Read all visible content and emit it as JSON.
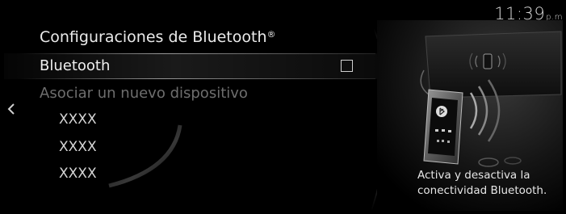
{
  "status": {
    "time": "11:39",
    "ampm": "p.m"
  },
  "menu": {
    "title": "Configuraciones de Bluetooth",
    "title_mark": "®",
    "bluetooth_label": "Bluetooth",
    "bluetooth_checked": false,
    "pair_label": "Asociar un nuevo dispositivo",
    "devices": [
      "XXXX",
      "XXXX",
      "XXXX"
    ]
  },
  "panel": {
    "description_line1": "Activa y desactiva la",
    "description_line2": "conectividad Bluetooth."
  },
  "icons": {
    "back": "chevron-left-icon",
    "bluetooth": "bluetooth-icon"
  }
}
